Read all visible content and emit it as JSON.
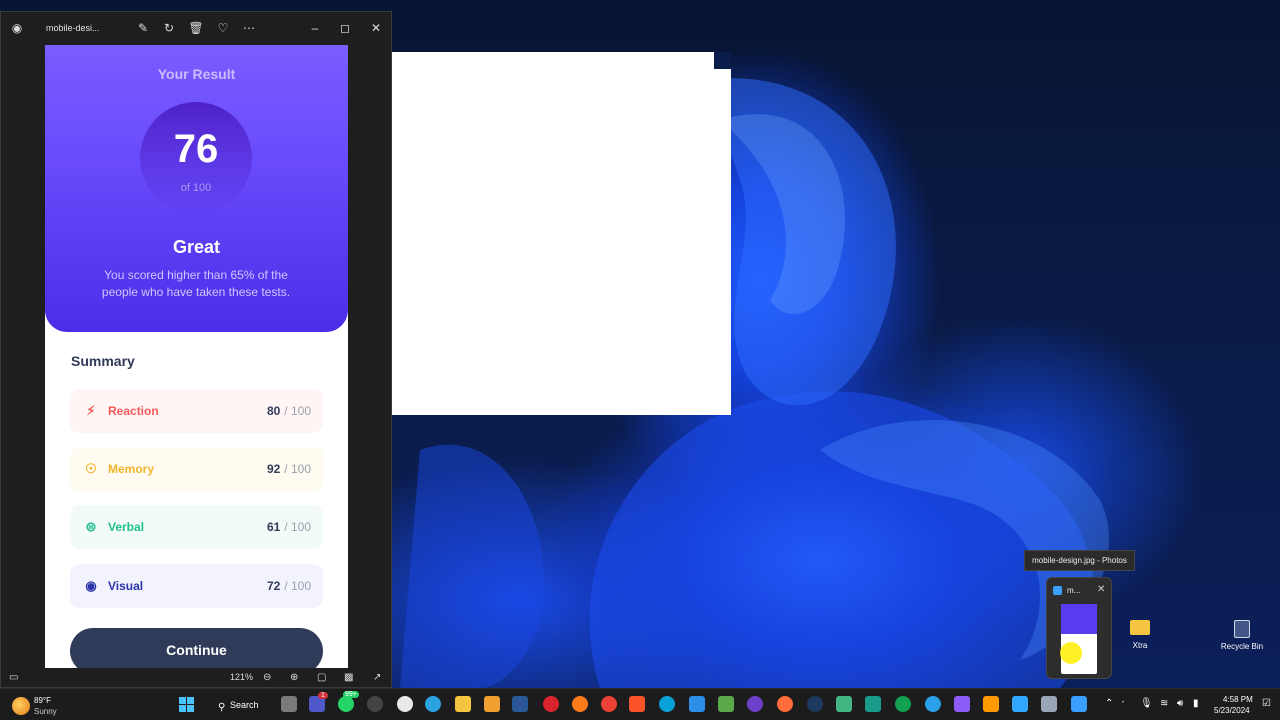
{
  "window": {
    "title": "mobile-desi...",
    "zoom": "121%"
  },
  "result": {
    "heading": "Your Result",
    "score": "76",
    "of_total": "of 100",
    "grade": "Great",
    "description": "You scored higher than 65% of the people who have taken these tests."
  },
  "summary": {
    "title": "Summary",
    "items": [
      {
        "label": "Reaction",
        "score": "80",
        "max": "/ 100",
        "color": "#f55a5a",
        "bg": "#fff5f4",
        "icon": "lightning-icon"
      },
      {
        "label": "Memory",
        "score": "92",
        "max": "/ 100",
        "color": "#f2b52a",
        "bg": "#fffbf0",
        "icon": "brain-icon"
      },
      {
        "label": "Verbal",
        "score": "61",
        "max": "/ 100",
        "color": "#1fbf8f",
        "bg": "#f2fbf8",
        "icon": "chat-icon"
      },
      {
        "label": "Visual",
        "score": "72",
        "max": "/ 100",
        "color": "#2b34a8",
        "bg": "#f3f3fd",
        "icon": "eye-icon"
      }
    ]
  },
  "continue_label": "Continue",
  "taskbar": {
    "weather_temp": "89°F",
    "weather_condition": "Sunny",
    "search_label": "Search",
    "badge_teams": "1",
    "badge_whatsapp": "99+",
    "time": "4:58 PM",
    "date": "5/23/2024"
  },
  "tooltip": "mobile-design.jpg - Photos",
  "preview_title": "m...",
  "desktop": {
    "folder_label": "Xtra",
    "recycle_label": "Recycle Bin"
  }
}
